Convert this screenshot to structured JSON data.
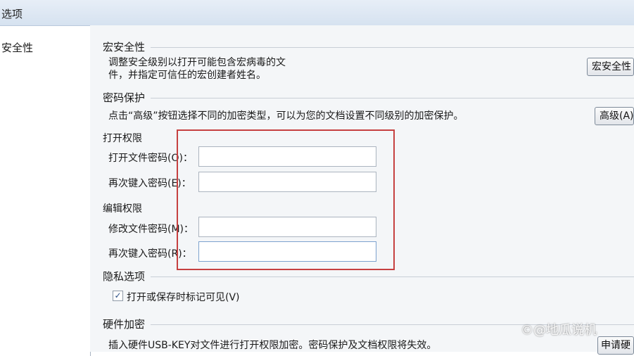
{
  "window": {
    "title": "选项"
  },
  "sidebar": {
    "items": [
      {
        "label": "安全性"
      }
    ]
  },
  "macro": {
    "heading": "宏安全性",
    "description_line1": "调整安全级别以打开可能包含宏病毒的文",
    "description_line2": "件，并指定可信任的宏创建者姓名。",
    "button_label": "宏安全性"
  },
  "password": {
    "heading": "密码保护",
    "description": "点击“高级”按钮选择不同的加密类型，可以为您的文档设置不同级别的加密保护。",
    "advanced_button_label": "高级(A)",
    "open_permission": {
      "heading": "打开权限",
      "open_password_label": "打开文件密码(O)：",
      "open_password_value": "",
      "reenter_label": "再次键入密码(E)：",
      "reenter_value": ""
    },
    "edit_permission": {
      "heading": "编辑权限",
      "modify_password_label": "修改文件密码(M)：",
      "modify_password_value": "",
      "reenter_label": "再次键入密码(R)：",
      "reenter_value": ""
    }
  },
  "privacy": {
    "heading": "隐私选项",
    "checkbox_label": "打开或保存时标记可见(V)",
    "checked": true
  },
  "hardware": {
    "heading": "硬件加密",
    "description": "插入硬件USB-KEY对文件进行打开权限加密。密码保护及文档权限将失效。",
    "button_label": "申请硬"
  },
  "watermark": {
    "text": "©@地瓜说机"
  }
}
